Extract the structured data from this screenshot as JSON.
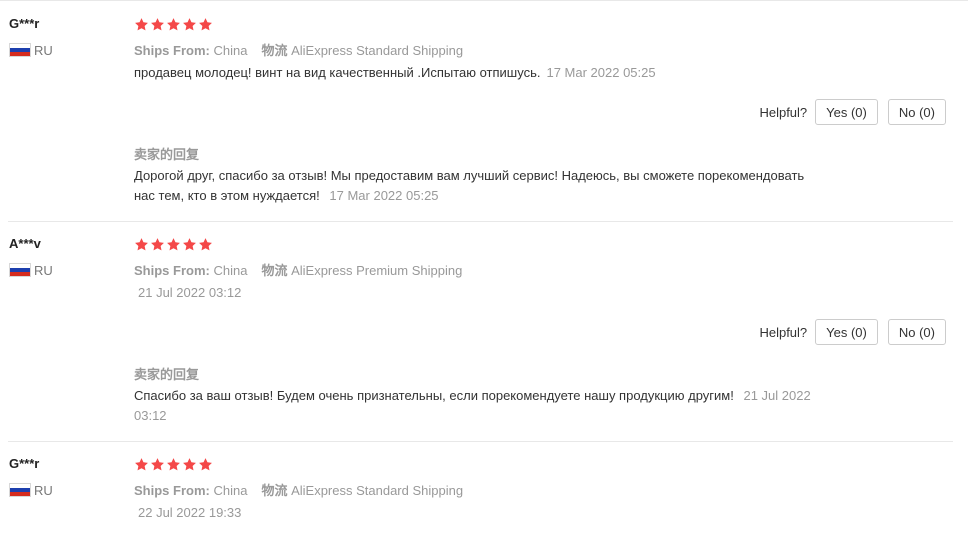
{
  "reviews": [
    {
      "user": "G***r",
      "country": "RU",
      "rating": 5,
      "ships_from_label": "Ships From:",
      "ships_from": "China",
      "logistics_label": "物流",
      "logistics": "AliExpress Standard Shipping",
      "text": "продавец молодец! винт на вид качественный .Испытаю отпишусь.",
      "date": "17 Mar 2022 05:25",
      "helpful_label": "Helpful?",
      "yes_label": "Yes (0)",
      "no_label": "No (0)",
      "seller_reply_title": "卖家的回复",
      "seller_reply": "Дорогой друг, спасибо за отзыв! Мы предоставим вам лучший сервис! Надеюсь, вы сможете порекомендовать нас тем, кто в этом нуждается!",
      "seller_reply_date": "17 Mar 2022 05:25"
    },
    {
      "user": "A***v",
      "country": "RU",
      "rating": 5,
      "ships_from_label": "Ships From:",
      "ships_from": "China",
      "logistics_label": "物流",
      "logistics": "AliExpress Premium Shipping",
      "text": "",
      "date": "21 Jul 2022 03:12",
      "helpful_label": "Helpful?",
      "yes_label": "Yes (0)",
      "no_label": "No (0)",
      "seller_reply_title": "卖家的回复",
      "seller_reply": "Спасибо за ваш отзыв! Будем очень признательны, если порекомендуете нашу продукцию другим!",
      "seller_reply_date": "21 Jul 2022 03:12"
    },
    {
      "user": "G***r",
      "country": "RU",
      "rating": 5,
      "ships_from_label": "Ships From:",
      "ships_from": "China",
      "logistics_label": "物流",
      "logistics": "AliExpress Standard Shipping",
      "text": "",
      "date": "22 Jul 2022 19:33"
    }
  ],
  "colors": {
    "star": "#f44848",
    "muted": "#999999",
    "text": "#333333",
    "divider": "#e8e8e8"
  },
  "icons": {
    "star": "star-icon",
    "flag": "russia-flag-icon"
  }
}
